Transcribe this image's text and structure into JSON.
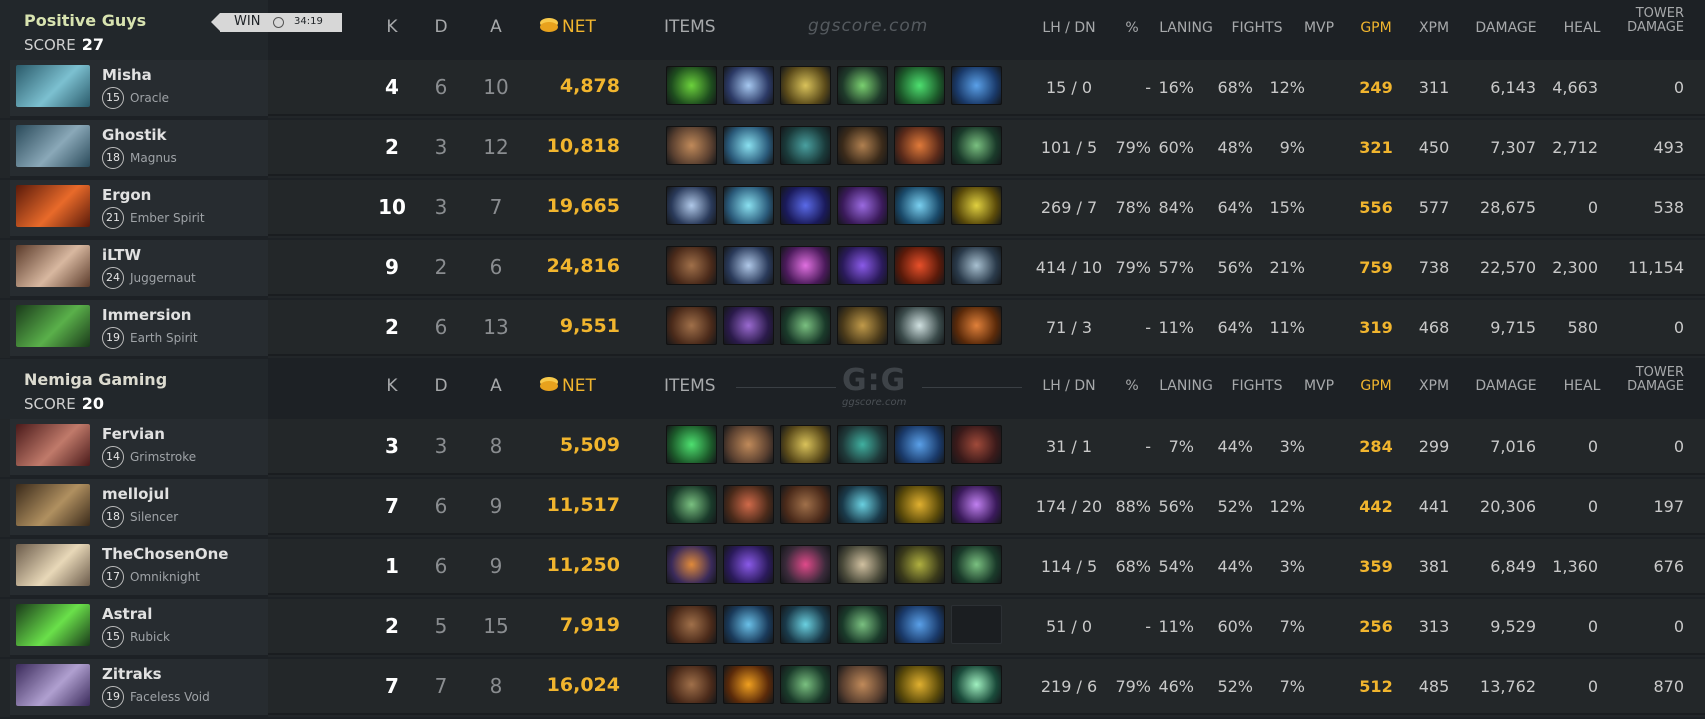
{
  "colors": {
    "gold": "#f1b52e",
    "bg": "#1d2125",
    "row": "#232729"
  },
  "win_badge": {
    "label": "WIN",
    "time": "34:19",
    "icon": "clock-icon"
  },
  "headers": {
    "k": "K",
    "d": "D",
    "a": "A",
    "net": "NET",
    "net_icon": "gold-coins-icon",
    "items": "ITEMS",
    "lh_dn": "LH  /  DN",
    "pct": "%",
    "laning": "LANING",
    "fights": "FIGHTS",
    "mvp": "MVP",
    "gpm": "GPM",
    "xpm": "XPM",
    "damage": "DAMAGE",
    "heal": "HEAL",
    "tower_1": "TOWER",
    "tower_2": "DAMAGE"
  },
  "watermark_1": "ggscore.com",
  "watermark_2": {
    "big": "G:G",
    "small": "ggscore.com"
  },
  "teams": [
    {
      "name": "Positive Guys",
      "score_label": "SCORE",
      "score": "27",
      "players": [
        {
          "name": "Misha",
          "level": "15",
          "hero": "Oracle",
          "k": "4",
          "d": "6",
          "a": "10",
          "net": "4,878",
          "lh": "15",
          "dn": "0",
          "pct": "-",
          "laning": "16%",
          "fights": "68%",
          "mvp": "12%",
          "gpm": "249",
          "xpm": "311",
          "damage": "6,143",
          "heal": "4,663",
          "tower": "0",
          "avatar_colors": [
            "#2a5a6a",
            "#7cc0d0"
          ],
          "items": [
            [
              "#1e4d1e",
              "#6cd23c"
            ],
            [
              "#2c3a66",
              "#a6c8f0"
            ],
            [
              "#5a4a1a",
              "#d9c25a"
            ],
            [
              "#1f3a2a",
              "#7ad070"
            ],
            [
              "#1c5a2a",
              "#4ee070"
            ],
            [
              "#1a3a6a",
              "#5aa0e8"
            ]
          ]
        },
        {
          "name": "Ghostik",
          "level": "18",
          "hero": "Magnus",
          "k": "2",
          "d": "3",
          "a": "12",
          "net": "10,818",
          "lh": "101",
          "dn": "5",
          "pct": "79%",
          "laning": "60%",
          "fights": "48%",
          "mvp": "9%",
          "gpm": "321",
          "xpm": "450",
          "damage": "7,307",
          "heal": "2,712",
          "tower": "493",
          "avatar_colors": [
            "#2a4a5a",
            "#8aa8b8"
          ],
          "items": [
            [
              "#5a4030",
              "#c08a5a"
            ],
            [
              "#2a5a7a",
              "#8ae0f0"
            ],
            [
              "#1a3a3a",
              "#4aa0a0"
            ],
            [
              "#3a2a1a",
              "#b08050"
            ],
            [
              "#5a2a1a",
              "#e07a3a"
            ],
            [
              "#1a3a2a",
              "#7ac080"
            ]
          ]
        },
        {
          "name": "Ergon",
          "level": "21",
          "hero": "Ember Spirit",
          "k": "10",
          "d": "3",
          "a": "7",
          "net": "19,665",
          "lh": "269",
          "dn": "7",
          "pct": "78%",
          "laning": "84%",
          "fights": "64%",
          "mvp": "15%",
          "gpm": "556",
          "xpm": "577",
          "damage": "28,675",
          "heal": "0",
          "tower": "538",
          "avatar_colors": [
            "#5a1a0a",
            "#e86a2a"
          ],
          "items": [
            [
              "#2a3a5a",
              "#b0c8e8"
            ],
            [
              "#2a5a7a",
              "#8ae0f0"
            ],
            [
              "#1a1a5a",
              "#5a6ae8"
            ],
            [
              "#3a1a5a",
              "#9a6ae0"
            ],
            [
              "#1a4a6a",
              "#7ad0f0"
            ],
            [
              "#5a4a0a",
              "#e0d040"
            ]
          ]
        },
        {
          "name": "iLTW",
          "level": "24",
          "hero": "Juggernaut",
          "k": "9",
          "d": "2",
          "a": "6",
          "net": "24,816",
          "lh": "414",
          "dn": "10",
          "pct": "79%",
          "laning": "57%",
          "fights": "56%",
          "mvp": "21%",
          "gpm": "759",
          "xpm": "738",
          "damage": "22,570",
          "heal": "2,300",
          "tower": "11,154",
          "avatar_colors": [
            "#5a3a2a",
            "#d8b8a0"
          ],
          "items": [
            [
              "#4a2a1a",
              "#a0704a"
            ],
            [
              "#2a3a5a",
              "#b0c8e8"
            ],
            [
              "#4a1a5a",
              "#e070e0"
            ],
            [
              "#2a1a5a",
              "#8a5ae8"
            ],
            [
              "#5a1a0a",
              "#e8502a"
            ],
            [
              "#2a3a4a",
              "#a8c0d0"
            ]
          ]
        },
        {
          "name": "Immersion",
          "level": "19",
          "hero": "Earth Spirit",
          "k": "2",
          "d": "6",
          "a": "13",
          "net": "9,551",
          "lh": "71",
          "dn": "3",
          "pct": "-",
          "laning": "11%",
          "fights": "64%",
          "mvp": "11%",
          "gpm": "319",
          "xpm": "468",
          "damage": "9,715",
          "heal": "580",
          "tower": "0",
          "avatar_colors": [
            "#1a3a1a",
            "#5ab04a"
          ],
          "items": [
            [
              "#4a2a1a",
              "#a0704a"
            ],
            [
              "#2a1a4a",
              "#9a6ad0"
            ],
            [
              "#1a3a2a",
              "#7ac080"
            ],
            [
              "#4a3a1a",
              "#c09a4a"
            ],
            [
              "#3a4a4a",
              "#d0e0e0"
            ],
            [
              "#5a2a0a",
              "#e0803a"
            ]
          ]
        }
      ]
    },
    {
      "name": "Nemiga Gaming",
      "score_label": "SCORE",
      "score": "20",
      "players": [
        {
          "name": "Fervian",
          "level": "14",
          "hero": "Grimstroke",
          "k": "3",
          "d": "3",
          "a": "8",
          "net": "5,509",
          "lh": "31",
          "dn": "1",
          "pct": "-",
          "laning": "7%",
          "fights": "44%",
          "mvp": "3%",
          "gpm": "284",
          "xpm": "299",
          "damage": "7,016",
          "heal": "0",
          "tower": "0",
          "avatar_colors": [
            "#4a1a1a",
            "#c07a6a"
          ],
          "items": [
            [
              "#1c5a2a",
              "#4ee070"
            ],
            [
              "#5a4030",
              "#c08a5a"
            ],
            [
              "#5a4a1a",
              "#d9c25a"
            ],
            [
              "#1f3a3a",
              "#40b0a0"
            ],
            [
              "#1a3a6a",
              "#5aa0e8"
            ],
            [
              "#3a1a1a",
              "#a04a3a"
            ]
          ]
        },
        {
          "name": "mellojul",
          "level": "18",
          "hero": "Silencer",
          "k": "7",
          "d": "6",
          "a": "9",
          "net": "11,517",
          "lh": "174",
          "dn": "20",
          "pct": "88%",
          "laning": "56%",
          "fights": "52%",
          "mvp": "12%",
          "gpm": "442",
          "xpm": "441",
          "damage": "20,306",
          "heal": "0",
          "tower": "197",
          "avatar_colors": [
            "#3a2a1a",
            "#b09060"
          ],
          "items": [
            [
              "#1a3a2a",
              "#7ac080"
            ],
            [
              "#4a2a1a",
              "#d06a4a"
            ],
            [
              "#4a2a1a",
              "#a0704a"
            ],
            [
              "#1a3a4a",
              "#6ad0e0"
            ],
            [
              "#5a4a0a",
              "#e0b030"
            ],
            [
              "#3a1a5a",
              "#c080f0"
            ]
          ]
        },
        {
          "name": "TheChosenOne",
          "level": "17",
          "hero": "Omniknight",
          "k": "1",
          "d": "6",
          "a": "9",
          "net": "11,250",
          "lh": "114",
          "dn": "5",
          "pct": "68%",
          "laning": "54%",
          "fights": "44%",
          "mvp": "3%",
          "gpm": "359",
          "xpm": "381",
          "damage": "6,849",
          "heal": "1,360",
          "tower": "676",
          "avatar_colors": [
            "#6a5a4a",
            "#e8d8b8"
          ],
          "items": [
            [
              "#3a2a5a",
              "#e08a3a"
            ],
            [
              "#2a1a5a",
              "#8a5ae8"
            ],
            [
              "#3a2a3a",
              "#e04a8a"
            ],
            [
              "#4a4a3a",
              "#d0c0a0"
            ],
            [
              "#3a3a1a",
              "#b0b040"
            ],
            [
              "#1a3a2a",
              "#7ac080"
            ]
          ]
        },
        {
          "name": "Astral",
          "level": "15",
          "hero": "Rubick",
          "k": "2",
          "d": "5",
          "a": "15",
          "net": "7,919",
          "lh": "51",
          "dn": "0",
          "pct": "-",
          "laning": "11%",
          "fights": "60%",
          "mvp": "7%",
          "gpm": "256",
          "xpm": "313",
          "damage": "9,529",
          "heal": "0",
          "tower": "0",
          "avatar_colors": [
            "#1a3a1a",
            "#6ae04a"
          ],
          "items": [
            [
              "#4a2a1a",
              "#a0704a"
            ],
            [
              "#1a3a5a",
              "#6ac0e8"
            ],
            [
              "#1a3a4a",
              "#6ad0e0"
            ],
            [
              "#1a3a2a",
              "#7ac080"
            ],
            [
              "#1a3a6a",
              "#5aa0e8"
            ]
          ]
        },
        {
          "name": "Zitraks",
          "level": "19",
          "hero": "Faceless Void",
          "k": "7",
          "d": "7",
          "a": "8",
          "net": "16,024",
          "lh": "219",
          "dn": "6",
          "pct": "79%",
          "laning": "46%",
          "fights": "52%",
          "mvp": "7%",
          "gpm": "512",
          "xpm": "485",
          "damage": "13,762",
          "heal": "0",
          "tower": "870",
          "avatar_colors": [
            "#3a2a5a",
            "#b0a0d0"
          ],
          "items": [
            [
              "#4a2a1a",
              "#a0704a"
            ],
            [
              "#5a2a0a",
              "#f0a020"
            ],
            [
              "#1a3a2a",
              "#7ac080"
            ],
            [
              "#5a4030",
              "#c08a5a"
            ],
            [
              "#5a4a0a",
              "#e0b030"
            ],
            [
              "#1a4a3a",
              "#a0f0c0"
            ]
          ]
        }
      ]
    }
  ]
}
